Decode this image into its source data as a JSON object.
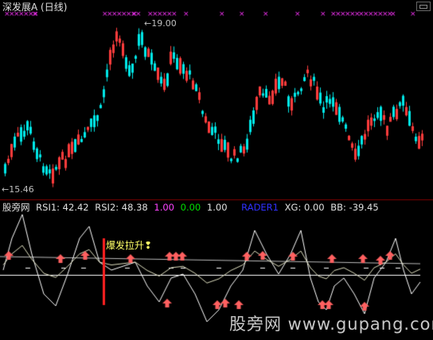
{
  "header": {
    "title": "深发展A",
    "period": "(日线)"
  },
  "price_panel": {
    "high_label": "19.00",
    "low_label": "15.46"
  },
  "indicator": {
    "name": "股旁网",
    "rsi1": "RSI1: 42.42",
    "rsi2": "RSI2: 48.38",
    "v1": "1.00",
    "v2": "0.00",
    "v3": "1.00",
    "rader": "RADER1",
    "xg": "XG: 0.00",
    "bb": "BB: -39.45",
    "signal_text": "爆发拉升",
    "signal_icon": "bulb-icon"
  },
  "watermark": "股旁网 www.gupang.com",
  "colors": {
    "up": "#ff3c3c",
    "down": "#00e8e8",
    "rsi_line": "#ffffff",
    "markers": "#ff33ff",
    "arrow": "#ff6060",
    "signal_bar": "#ff2020",
    "signal_text": "#ffff66",
    "rader": "#3030ff",
    "green": "#00e000",
    "magenta": "#ff44ff"
  }
}
